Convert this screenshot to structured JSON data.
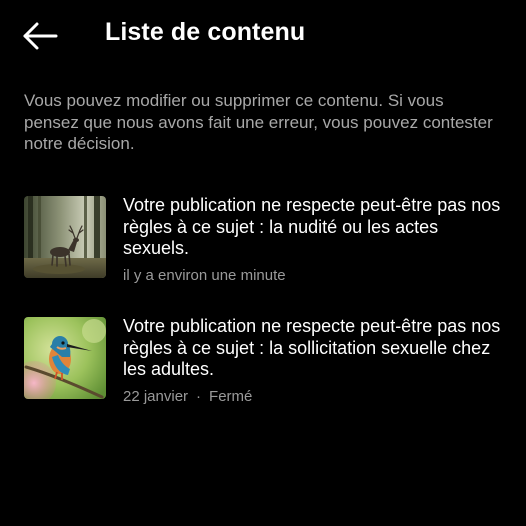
{
  "header": {
    "title": "Liste de contenu",
    "back_icon": "arrow-left-icon"
  },
  "intro": {
    "text": "Vous pouvez modifier ou supprimer ce contenu. Si vous pensez que nous avons fait une erreur, vous pouvez contester notre décision."
  },
  "items": [
    {
      "thumbnail": "deer-in-forest-photo",
      "title": "Votre publication ne respecte peut-être pas nos règles à ce sujet : la nudité ou les actes sexuels.",
      "time": "il y a environ une minute",
      "status": ""
    },
    {
      "thumbnail": "kingfisher-bird-photo",
      "title": "Votre publication ne respecte peut-être pas nos règles à ce sujet : la sollicitation sexuelle chez les adultes.",
      "time": "22 janvier",
      "separator": "·",
      "status": "Fermé"
    }
  ]
}
